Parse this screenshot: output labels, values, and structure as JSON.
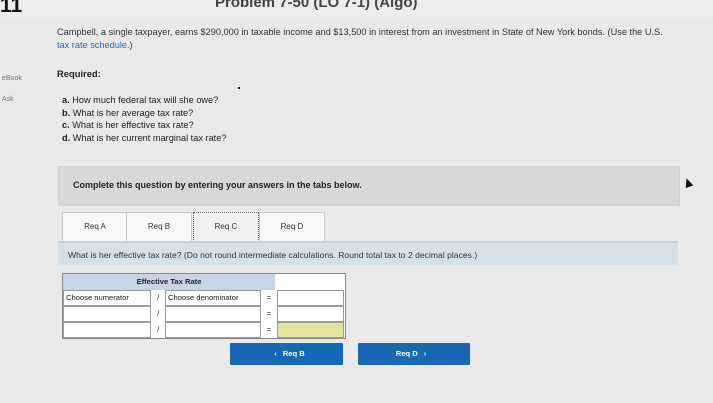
{
  "header": {
    "problem_number": "11",
    "problem_title": "Problem 7-50 (LO 7-1) (Algo)"
  },
  "sidebar": {
    "ebook_label": "eBook",
    "ask_label": "Ask"
  },
  "question": {
    "text_before_link": "Campbell, a single taxpayer, earns $290,000 in taxable income and $13,500 in interest from an investment in State of New York bonds. (Use the U.S. ",
    "link_text": "tax rate schedule.",
    "text_after_link": ")",
    "required_label": "Required:",
    "items": [
      {
        "letter": "a.",
        "text": "How much federal tax will she owe?"
      },
      {
        "letter": "b.",
        "text": "What is her average tax rate?"
      },
      {
        "letter": "c.",
        "text": "What is her effective tax rate?"
      },
      {
        "letter": "d.",
        "text": "What is her current marginal tax rate?"
      }
    ]
  },
  "instructions": "Complete this question by entering your answers in the tabs below.",
  "tabs": [
    {
      "label": "Req A",
      "active": false
    },
    {
      "label": "Req B",
      "active": false
    },
    {
      "label": "Req C",
      "active": true
    },
    {
      "label": "Req D",
      "active": false
    }
  ],
  "prompt": "What is her effective tax rate? (Do not round intermediate calculations. Round total tax to 2 decimal places.)",
  "effective_table": {
    "title": "Effective Tax Rate",
    "rows": [
      {
        "numerator": "Choose numerator",
        "divider": "/",
        "denominator": "Choose denominator",
        "equals": "=",
        "result": ""
      },
      {
        "numerator": "",
        "divider": "/",
        "denominator": "",
        "equals": "=",
        "result": ""
      },
      {
        "numerator": "",
        "divider": "/",
        "denominator": "",
        "equals": "=",
        "result": ""
      }
    ]
  },
  "navigation": {
    "prev_label": "Req B",
    "next_label": "Req D",
    "prev_icon": "chevron-left-icon",
    "next_icon": "chevron-right-icon"
  },
  "colors": {
    "nav_button": "#1769b6",
    "table_title_bg": "#c6d5e6",
    "highlight_cell": "#e4e2a0",
    "link": "#2a67b2"
  }
}
